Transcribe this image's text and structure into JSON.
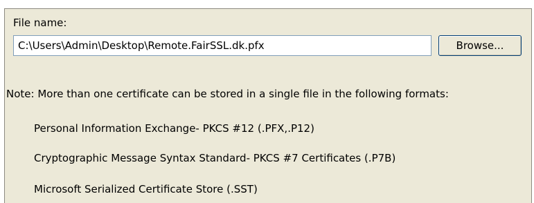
{
  "file_section": {
    "label": "File name:",
    "value": "C:\\Users\\Admin\\Desktop\\Remote.FairSSL.dk.pfx",
    "browse_label": "Browse..."
  },
  "note": "Note:  More than one certificate can be stored in a single file in the following formats:",
  "formats": [
    "Personal Information Exchange- PKCS #12 (.PFX,.P12)",
    "Cryptographic Message Syntax Standard- PKCS #7 Certificates (.P7B)",
    "Microsoft Serialized Certificate Store (.SST)"
  ]
}
